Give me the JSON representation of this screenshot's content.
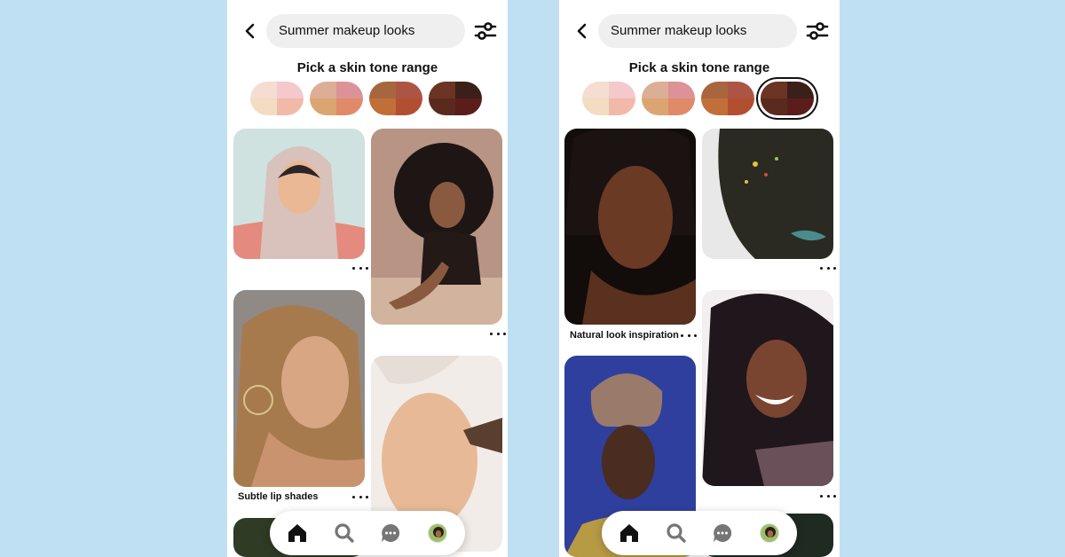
{
  "screens": [
    {
      "search": {
        "query": "Summer makeup looks"
      },
      "heading": "Pick a skin tone range",
      "selected_swatch": null,
      "pins": [
        {
          "subject": "woman-in-hijab-portrait",
          "caption": ""
        },
        {
          "subject": "woman-with-afro-portrait",
          "caption": ""
        },
        {
          "subject": "woman-with-hoop-earring-portrait",
          "caption": "Subtle lip shades"
        },
        {
          "subject": "woman-applying-makeup-brush",
          "caption": ""
        },
        {
          "subject": "partial-pin-bottom",
          "caption": ""
        }
      ]
    },
    {
      "search": {
        "query": "Summer makeup looks"
      },
      "heading": "Pick a skin tone range",
      "selected_swatch": 3,
      "pins": [
        {
          "subject": "dark-skin-woman-portrait",
          "caption": "Natural look inspiration"
        },
        {
          "subject": "woman-with-glitter-face-paint",
          "caption": ""
        },
        {
          "subject": "woman-with-head-wrap-portrait",
          "caption": ""
        },
        {
          "subject": "smiling-woman-with-long-hair",
          "caption": ""
        },
        {
          "subject": "partial-pin-bottom",
          "caption": ""
        }
      ]
    }
  ],
  "swatches": [
    {
      "colors": [
        "#f5ddd1",
        "#f3c9cc",
        "#f2dcc2",
        "#f2b9a9"
      ]
    },
    {
      "colors": [
        "#ddae96",
        "#dc9296",
        "#dba571",
        "#e08a6a"
      ]
    },
    {
      "colors": [
        "#a8663f",
        "#ad5544",
        "#c06f38",
        "#b24f30"
      ]
    },
    {
      "colors": [
        "#6b3424",
        "#3b2019",
        "#5a2a1e",
        "#5b1d1c"
      ]
    }
  ],
  "nav": {
    "items": [
      "home-icon",
      "search-icon",
      "messages-icon",
      "profile-avatar"
    ],
    "active": "home-icon"
  },
  "colors": {
    "background": "#bfe0f2",
    "panel": "#ffffff",
    "search_field": "#efefef",
    "text": "#111111"
  }
}
